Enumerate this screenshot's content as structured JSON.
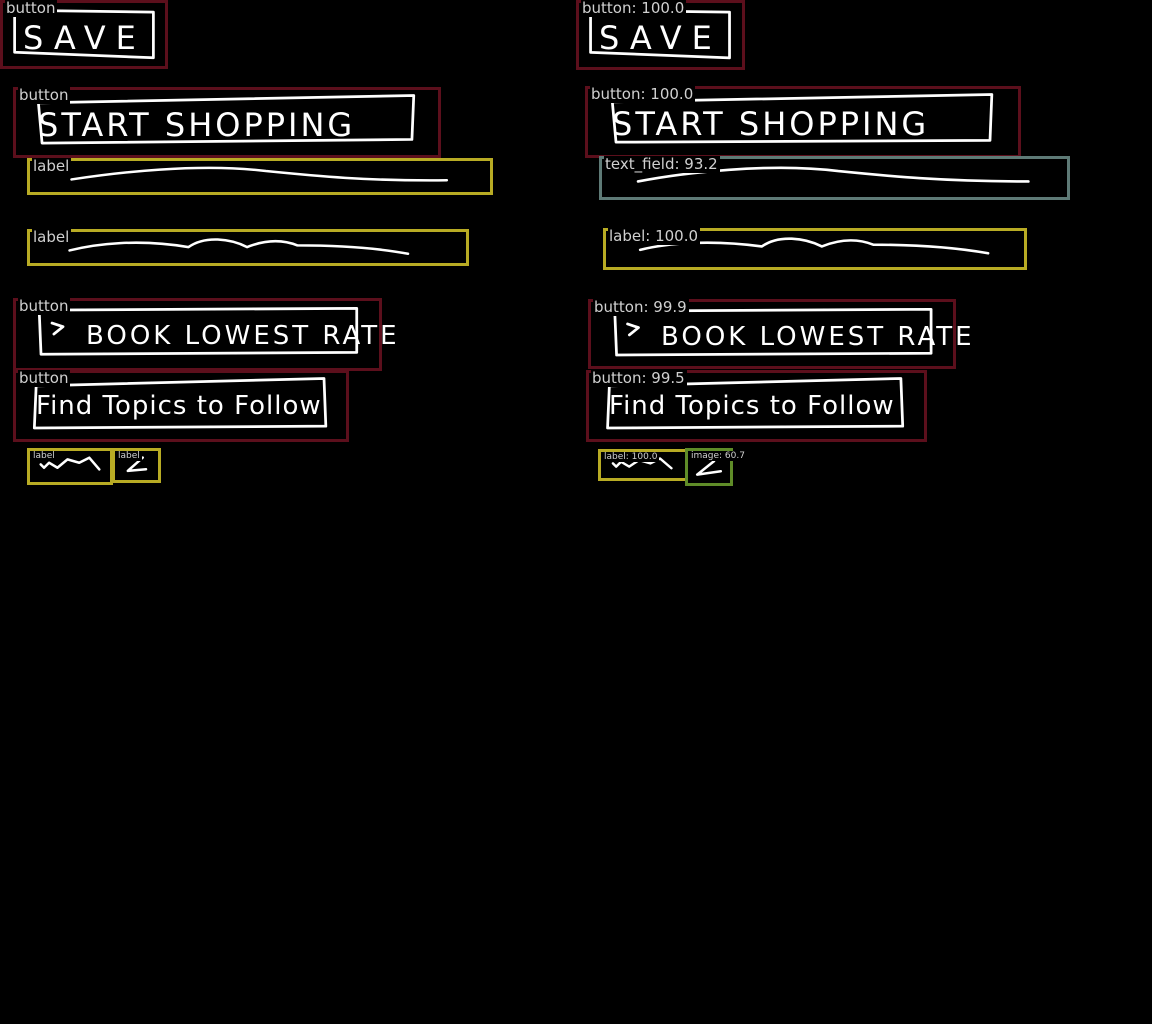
{
  "sketch_text": {
    "save": "SAVE",
    "start_shopping": "START SHOPPING",
    "book_lowest_rate": "BOOK LOWEST RATE",
    "find_topics": "Find Topics to Follow"
  },
  "left_panel": {
    "detections": [
      {
        "type": "button",
        "tag": "button"
      },
      {
        "type": "button",
        "tag": "button"
      },
      {
        "type": "label",
        "tag": "label"
      },
      {
        "type": "label",
        "tag": "label"
      },
      {
        "type": "button",
        "tag": "button"
      },
      {
        "type": "button",
        "tag": "button"
      },
      {
        "type": "label",
        "tag": "label"
      },
      {
        "type": "label",
        "tag": "label"
      }
    ]
  },
  "right_panel": {
    "detections": [
      {
        "type": "button",
        "tag": "button: 100.0"
      },
      {
        "type": "button",
        "tag": "button: 100.0"
      },
      {
        "type": "text_field",
        "tag": "text_field: 93.2"
      },
      {
        "type": "label",
        "tag": "label: 100.0"
      },
      {
        "type": "button",
        "tag": "button: 99.9"
      },
      {
        "type": "button",
        "tag": "button: 99.5"
      },
      {
        "type": "label",
        "tag": "label: 100.0"
      },
      {
        "type": "image",
        "tag": "image: 60.7"
      }
    ]
  },
  "colors": {
    "background": "#000000",
    "button_box": "#5c0f1c",
    "label_box": "#b8ab24",
    "text_field_box": "#5e7a76",
    "image_box": "#5f8c28",
    "sketch_stroke": "#ffffff",
    "tag_text": "#d0d0d0"
  }
}
